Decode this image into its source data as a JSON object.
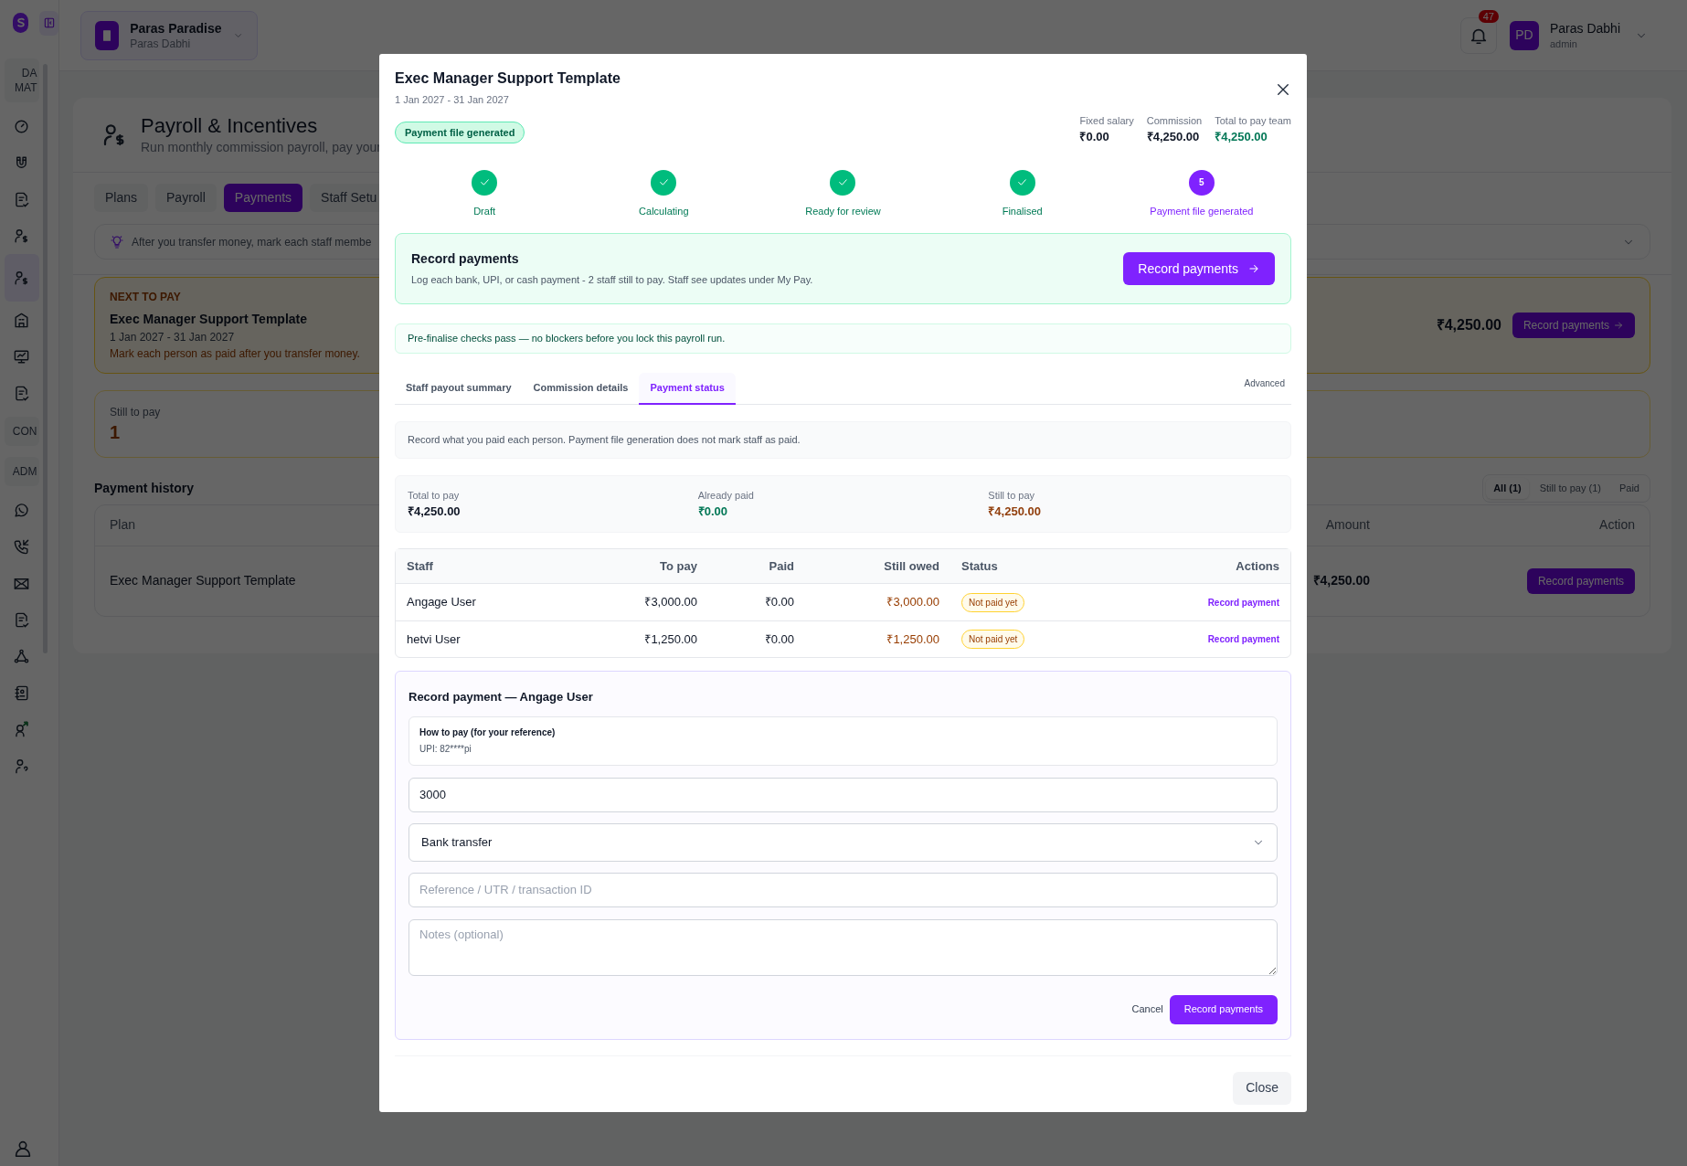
{
  "sidebar": {
    "items": [
      {
        "kind": "section",
        "label": "DA MAT"
      },
      {
        "kind": "link",
        "selected": false
      },
      {
        "kind": "link",
        "selected": false
      },
      {
        "kind": "link",
        "selected": false
      },
      {
        "kind": "link",
        "selected": false
      },
      {
        "kind": "link",
        "selected": true
      },
      {
        "kind": "link",
        "selected": false
      },
      {
        "kind": "link",
        "selected": false
      },
      {
        "kind": "link",
        "selected": false
      },
      {
        "kind": "section",
        "label": "CON"
      },
      {
        "kind": "section",
        "label": "ADM"
      },
      {
        "kind": "link",
        "selected": false
      },
      {
        "kind": "link",
        "selected": false
      },
      {
        "kind": "link",
        "selected": false
      },
      {
        "kind": "link",
        "selected": false
      },
      {
        "kind": "link",
        "selected": false
      },
      {
        "kind": "link",
        "selected": false
      },
      {
        "kind": "link",
        "selected": false
      },
      {
        "kind": "link",
        "selected": false
      }
    ]
  },
  "header": {
    "workspace": {
      "name": "Paras Paradise",
      "owner": "Paras Dabhi"
    },
    "notifications": {
      "count": "47"
    },
    "user": {
      "initials": "PD",
      "name": "Paras Dabhi",
      "role": "admin"
    }
  },
  "page": {
    "title": "Payroll & Incentives",
    "subtitle": "Run monthly commission payroll, pay your",
    "tabs": [
      {
        "label": "Plans",
        "selected": false
      },
      {
        "label": "Payroll",
        "selected": false
      },
      {
        "label": "Payments",
        "selected": true
      },
      {
        "label": "Staff Setu",
        "selected": false
      }
    ],
    "tip": "After you transfer money, mark each staff membe",
    "next_to_pay": {
      "label": "NEXT TO PAY",
      "plan": "Exec Manager Support Template",
      "period": "1 Jan 2027 - 31 Jan 2027",
      "note": "Mark each person as paid after you transfer money.",
      "amount": "₹4,250.00",
      "button": "Record payments"
    },
    "still_to_pay": {
      "label": "Still to pay",
      "value": "1"
    },
    "history": {
      "title": "Payment history",
      "filters": [
        {
          "label": "All (1)",
          "selected": true
        },
        {
          "label": "Still to pay (1)",
          "selected": false
        },
        {
          "label": "Paid",
          "selected": false
        }
      ],
      "columns": [
        "Plan",
        "Amount",
        "Action"
      ],
      "rows": [
        {
          "plan": "Exec Manager Support Template",
          "amount": "₹4,250.00",
          "action": "Record payments"
        }
      ]
    }
  },
  "modal": {
    "title": "Exec Manager Support Template",
    "period": "1 Jan 2027 - 31 Jan 2027",
    "status": "Payment file generated",
    "totals": [
      {
        "label": "Fixed salary",
        "value": "₹0.00",
        "color": "#111827"
      },
      {
        "label": "Commission",
        "value": "₹4,250.00",
        "color": "#111827"
      },
      {
        "label": "Total to pay team",
        "value": "₹4,250.00",
        "color": "#047857"
      }
    ],
    "steps": [
      {
        "label": "Draft",
        "done": true,
        "current": false
      },
      {
        "label": "Calculating",
        "done": true,
        "current": false
      },
      {
        "label": "Ready for review",
        "done": true,
        "current": false
      },
      {
        "label": "Finalised",
        "done": true,
        "current": false
      },
      {
        "label": "Payment file generated",
        "done": false,
        "current": true,
        "number": "5"
      }
    ],
    "callout": {
      "title": "Record payments",
      "text": "Log each bank, UPI, or cash payment - 2 staff still to pay. Staff see updates under My Pay.",
      "button": "Record payments"
    },
    "checks": "Pre-finalise checks pass — no blockers before you lock this payroll run.",
    "tabs": [
      {
        "label": "Staff payout summary",
        "selected": false
      },
      {
        "label": "Commission details",
        "selected": false
      },
      {
        "label": "Payment status",
        "selected": true
      }
    ],
    "advanced": "Advanced",
    "info": "Record what you paid each person. Payment file generation does not mark staff as paid.",
    "summary": [
      {
        "label": "Total to pay",
        "value": "₹4,250.00",
        "color": "#111827"
      },
      {
        "label": "Already paid",
        "value": "₹0.00",
        "color": "#047857"
      },
      {
        "label": "Still to pay",
        "value": "₹4,250.00",
        "color": "#92400e"
      }
    ],
    "table": {
      "columns": [
        "Staff",
        "To pay",
        "Paid",
        "Still owed",
        "Status",
        "Actions"
      ],
      "rows": [
        {
          "staff": "Angage User",
          "to_pay": "₹3,000.00",
          "paid": "₹0.00",
          "still_owed": "₹3,000.00",
          "status": "Not paid yet",
          "action": "Record payment"
        },
        {
          "staff": "hetvi User",
          "to_pay": "₹1,250.00",
          "paid": "₹0.00",
          "still_owed": "₹1,250.00",
          "status": "Not paid yet",
          "action": "Record payment"
        }
      ]
    },
    "form": {
      "title": "Record payment — Angage User",
      "reference_title": "How to pay (for your reference)",
      "reference": "UPI: 82****pi",
      "amount": "3000",
      "method": "Bank transfer",
      "reference_placeholder": "Reference / UTR / transaction ID",
      "notes_placeholder": "Notes (optional)",
      "cancel": "Cancel",
      "submit": "Record payments"
    },
    "close": "Close"
  }
}
